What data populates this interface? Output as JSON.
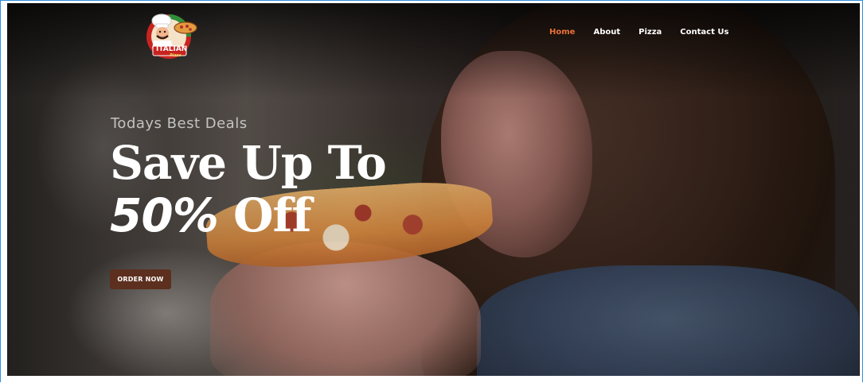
{
  "brand": {
    "logo_text": "ITALIAN",
    "logo_subtext": "Pizza"
  },
  "nav": {
    "items": [
      {
        "label": "Home",
        "active": true
      },
      {
        "label": "About",
        "active": false
      },
      {
        "label": "Pizza",
        "active": false
      },
      {
        "label": "Contact Us",
        "active": false
      }
    ]
  },
  "hero": {
    "kicker": "Todays Best Deals",
    "headline_line1": "Save Up To",
    "headline_pct": "50%",
    "headline_rest": " Off",
    "cta_label": "ORDER NOW"
  },
  "colors": {
    "accent": "#e8733a",
    "button": "#5c2f1e",
    "frame": "#2f8fe0"
  }
}
